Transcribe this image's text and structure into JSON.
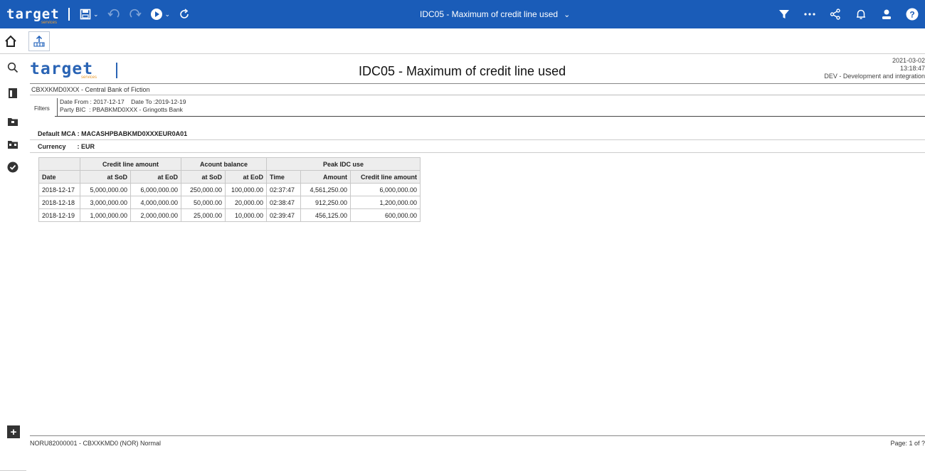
{
  "app": {
    "brand": "target",
    "brand_sub": "services",
    "window_title": "IDC05 - Maximum of credit line used"
  },
  "icons": {
    "save": "save-icon",
    "undo": "undo-icon",
    "redo": "redo-icon",
    "run": "run-icon",
    "refresh": "refresh-icon",
    "filter": "filter-icon",
    "more": "more-icon",
    "share": "share-icon",
    "notifications": "bell-icon",
    "user": "user-icon",
    "help": "help-icon",
    "home": "home-icon",
    "upload": "upload-icon"
  },
  "colors": {
    "topbar": "#1a5cb8",
    "brand_accent": "#f0a030"
  },
  "report": {
    "logo_text": "target",
    "logo_sub": "services",
    "title": "IDC05 - Maximum of credit line used",
    "date": "2021-03-02",
    "time": "13:18:47",
    "environment": "DEV - Development and integration",
    "party": "CBXXKMD0XXX - Central Bank of Fiction",
    "filters_label": "Filters",
    "filter_line1": "Date From : 2017-12-17    Date To :2019-12-19",
    "filter_line2": "Party BIC  : PBABKMD0XXX - Gringotts Bank",
    "default_mca": "Default MCA : MACASHPBABKMD0XXXEUR0A01",
    "currency_label": "Currency",
    "currency_value": ": EUR"
  },
  "table": {
    "group_headers": [
      "Credit line amount",
      "Acount balance",
      "Peak IDC use"
    ],
    "columns": [
      "Date",
      "at SoD",
      "at EoD",
      "at SoD",
      "at EoD",
      "Time",
      "Amount",
      "Credit line amount"
    ],
    "rows": [
      [
        "2018-12-17",
        "5,000,000.00",
        "6,000,000.00",
        "250,000.00",
        "100,000.00",
        "02:37:47",
        "4,561,250.00",
        "6,000,000.00"
      ],
      [
        "2018-12-18",
        "3,000,000.00",
        "4,000,000.00",
        "50,000.00",
        "20,000.00",
        "02:38:47",
        "912,250.00",
        "1,200,000.00"
      ],
      [
        "2018-12-19",
        "1,000,000.00",
        "2,000,000.00",
        "25,000.00",
        "10,000.00",
        "02:39:47",
        "456,125.00",
        "600,000.00"
      ]
    ]
  },
  "footer": {
    "left": "NORU82000001 - CBXXKMD0 (NOR) Normal",
    "page": "Page: 1 of ?"
  }
}
